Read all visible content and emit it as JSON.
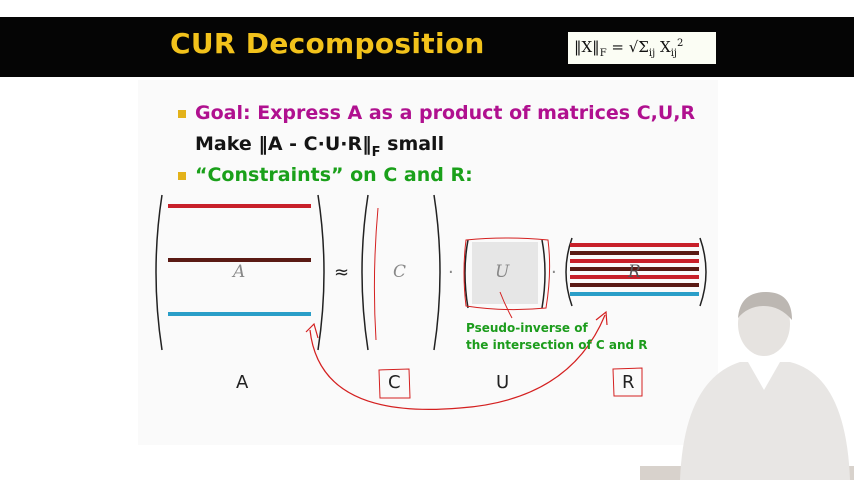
{
  "slide": {
    "title": "CUR Decomposition",
    "formula": "‖X‖F = √Σij Xij²",
    "bullet1": "Goal: Express A as a product of matrices C,U,R",
    "bullet1_sub_prefix": "Make ‖A - C·U·R‖",
    "bullet1_sub_subscript": "F",
    "bullet1_sub_suffix": " small",
    "bullet2": "“Constraints” on C and R:",
    "approx_symbol": "≈",
    "dot_symbol": "·",
    "matrix_A_italic": "A",
    "matrix_C_italic": "C",
    "matrix_U_italic": "U",
    "matrix_R_italic": "R",
    "label_A": "A",
    "label_C": "C",
    "label_U": "U",
    "label_R": "R",
    "note_line1": "Pseudo-inverse of",
    "note_line2": "the intersection of C and R"
  },
  "colors": {
    "header_bg": "#050505",
    "title": "#f2c21b",
    "goal_text": "#b0108f",
    "constraints_text": "#1aa01a",
    "bullet": "#e3b21a",
    "annotation_red": "#d42020",
    "row_red": "#c8202a",
    "row_dark": "#5a1a14",
    "row_blue": "#2a9ec8"
  }
}
